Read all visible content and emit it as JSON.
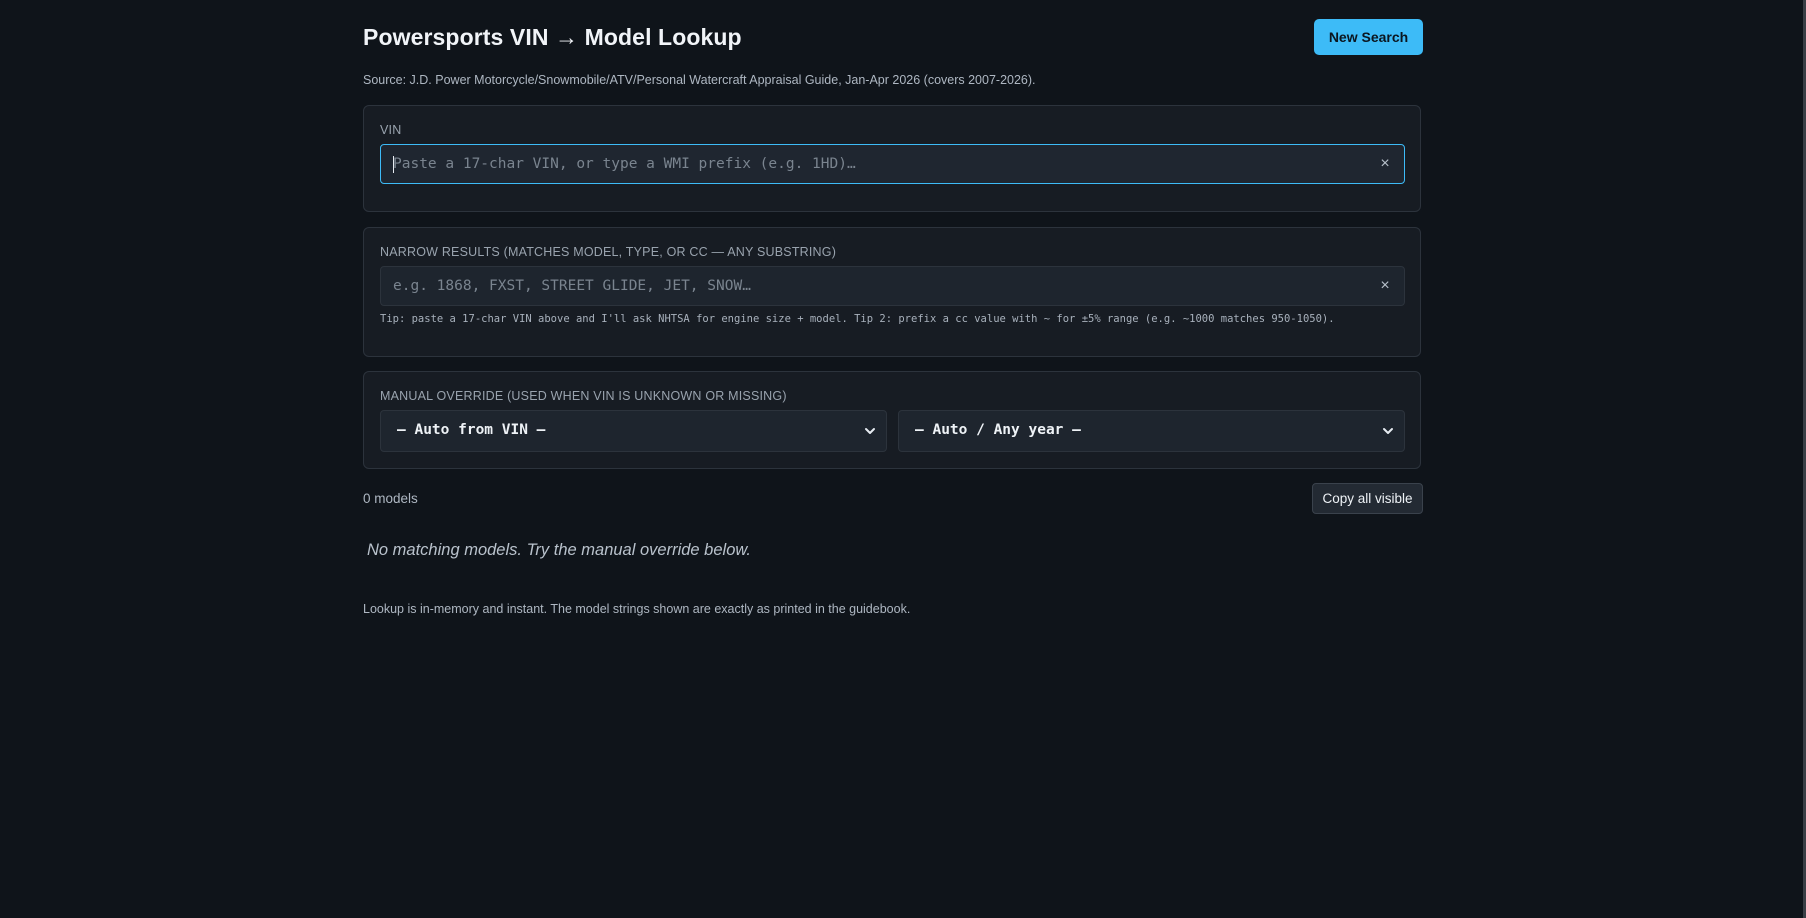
{
  "header": {
    "title": "Powersports VIN → Model Lookup",
    "new_search_label": "New Search",
    "source": "Source: J.D. Power Motorcycle/Snowmobile/ATV/Personal Watercraft Appraisal Guide, Jan-Apr 2026 (covers 2007-2026)."
  },
  "vin": {
    "label": "VIN",
    "value": "",
    "placeholder": "Paste a 17-char VIN, or type a WMI prefix (e.g. 1HD)…",
    "clear": "×"
  },
  "narrow": {
    "label": "NARROW RESULTS (MATCHES MODEL, TYPE, OR CC — ANY SUBSTRING)",
    "value": "",
    "placeholder": "e.g. 1868, FXST, STREET GLIDE, JET, SNOW…",
    "clear": "×",
    "tip": "Tip: paste a 17-char VIN above and I'll ask NHTSA for engine size + model. Tip 2: prefix a cc value with ~ for ±5% range (e.g. ~1000 matches 950-1050)."
  },
  "manual": {
    "label": "MANUAL OVERRIDE (USED WHEN VIN IS UNKNOWN OR MISSING)",
    "make_selected": "– Auto from VIN –",
    "year_selected": "– Auto / Any year –"
  },
  "results": {
    "count": "0 models",
    "copy_label": "Copy all visible",
    "empty_message": "No matching models. Try the manual override below."
  },
  "footer": {
    "note": "Lookup is in-memory and instant. The model strings shown are exactly as printed in the guidebook."
  },
  "colors": {
    "background": "#0f141a",
    "accent": "#3dbbf7",
    "panel": "#171c23"
  }
}
